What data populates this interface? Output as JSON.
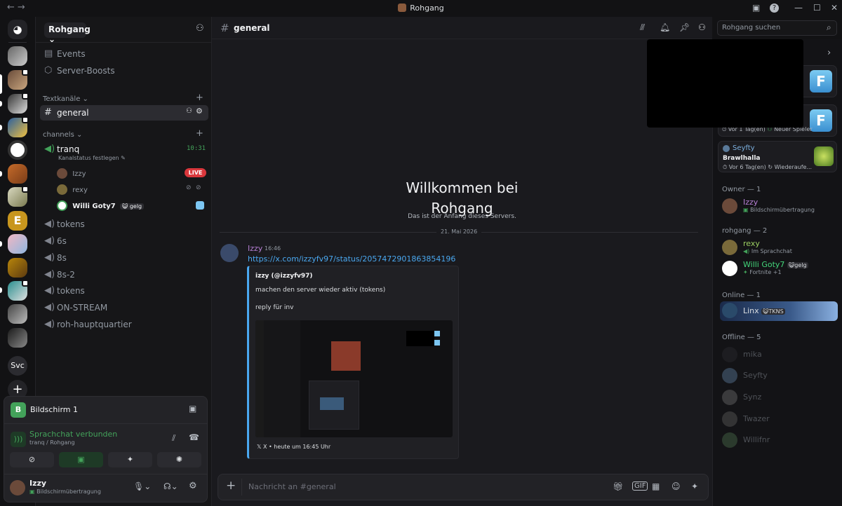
{
  "window": {
    "title": "Rohgang"
  },
  "server": {
    "name": "Rohgang",
    "name_caret": "Rohgang ⌄"
  },
  "sidebar": {
    "top_items": [
      {
        "label": "Events"
      },
      {
        "label": "Server-Boosts"
      }
    ],
    "text_category": "Textkanäle",
    "voice_category": "channels",
    "text_channels": [
      {
        "name": "general"
      }
    ],
    "voice_channel": {
      "name": "tranq",
      "status": "Kanalstatus festlegen",
      "timer": "10:31"
    },
    "voice_users": [
      {
        "name": "Izzy",
        "badge": "LIVE"
      },
      {
        "name": "rexy"
      },
      {
        "name": "Willi Goty7",
        "tag": "gelg"
      }
    ],
    "other_channels": [
      {
        "name": "tokens"
      },
      {
        "name": "6s"
      },
      {
        "name": "8s"
      },
      {
        "name": "8s-2"
      },
      {
        "name": "tokens"
      },
      {
        "name": "ON-STREAM"
      },
      {
        "name": "roh-hauptquartier"
      }
    ]
  },
  "guilds": {
    "svc_label": "Svc"
  },
  "panel": {
    "stream_title": "Bildschirm 1",
    "voice_status": "Sprachchat verbunden",
    "voice_location": "tranq / Rohgang",
    "user_name": "Izzy",
    "user_status": "Bildschirmübertragung"
  },
  "chat": {
    "channel": "general",
    "search_placeholder": "Rohgang suchen",
    "welcome_line1": "Willkommen bei",
    "welcome_line2": "Rohgang",
    "welcome_sub": "Das ist der Anfang dieses Servers.",
    "date_divider": "21. Mai 2026",
    "message": {
      "author": "Izzy",
      "time": "16:46",
      "link": "https://x.com/izzyfv97/status/2057472901863854196",
      "embed_author": "izzy (@izzyfv97)",
      "embed_line1": "machen den server wieder aktiv (tokens)",
      "embed_line2": "reply für inv",
      "embed_footer": "X • heute um 16:45 Uhr"
    },
    "composer_placeholder": "Nachricht an #general"
  },
  "members": {
    "activities": [
      {
        "meta": "Vor 1 Tag(en)",
        "extra": "Neuer Spieler"
      },
      {
        "name": "Seyfty",
        "game": "Brawlhalla",
        "meta": "Vor 6 Tag(en)",
        "extra": "Wiederaufe..."
      }
    ],
    "groups": [
      {
        "header": "Owner — 1",
        "members": [
          {
            "name": "Izzy",
            "status": "Bildschirmübertragung",
            "color": "#b67fd4"
          }
        ]
      },
      {
        "header": "rohgang — 2",
        "members": [
          {
            "name": "rexy",
            "status": "Im Sprachchat",
            "color": "#9ccf62"
          },
          {
            "name": "Willi Goty7",
            "tag": "gelg",
            "status": "Fortnite +1",
            "color": "#43d67a"
          }
        ]
      },
      {
        "header": "Online — 1",
        "members": [
          {
            "name": "Linx",
            "tag": "TKNS",
            "color": "#dbdee1"
          }
        ]
      },
      {
        "header": "Offline — 5",
        "members": [
          {
            "name": "mika"
          },
          {
            "name": "Seyfty"
          },
          {
            "name": "Synz"
          },
          {
            "name": "Twazer"
          },
          {
            "name": "Willifnr"
          }
        ]
      }
    ]
  },
  "colors": {
    "accent_link": "#4aa8f0",
    "live_red": "#da373c",
    "voice_green": "#43a25a",
    "author_purple": "#b67fd4"
  }
}
